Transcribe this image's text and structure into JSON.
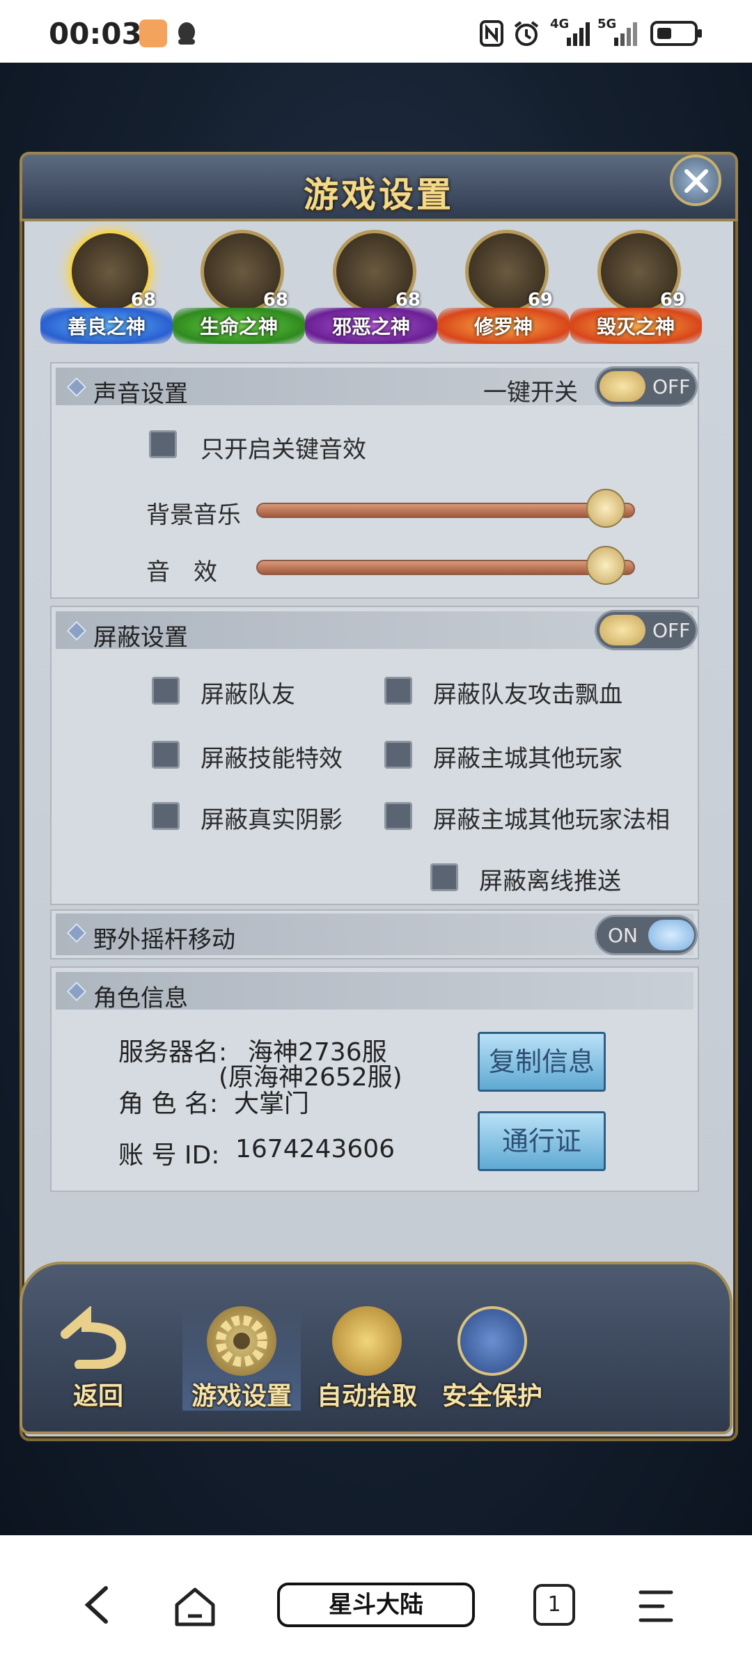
{
  "status_bar": {
    "time": "00:03",
    "icons": [
      "app-notification-icon",
      "qq-icon",
      "nfc-icon",
      "alarm-icon",
      "signal-4g-icon",
      "signal-5g-icon",
      "battery-icon"
    ],
    "signal_4g": "4G",
    "signal_5g": "5G"
  },
  "dialog": {
    "title": "游戏设置"
  },
  "gods": [
    {
      "name": "善良之神",
      "level": "68",
      "color": "#5fb8ff"
    },
    {
      "name": "生命之神",
      "level": "68",
      "color": "#6fd34a"
    },
    {
      "name": "邪恶之神",
      "level": "68",
      "color": "#b05ad8"
    },
    {
      "name": "修罗神",
      "level": "69",
      "color": "#ff7a2a"
    },
    {
      "name": "毁灭之神",
      "level": "69",
      "color": "#ff7a2a"
    }
  ],
  "sound": {
    "title": "声音设置",
    "master_label": "一键开关",
    "master_state": "OFF",
    "key_sound_only": "只开启关键音效",
    "bgm_label": "背景音乐",
    "sfx_label": "音　效",
    "bgm_level": 1.0,
    "sfx_level": 1.0
  },
  "block": {
    "title": "屏蔽设置",
    "state": "OFF",
    "options": [
      "屏蔽队友",
      "屏蔽队友攻击飘血",
      "屏蔽技能特效",
      "屏蔽主城其他玩家",
      "屏蔽真实阴影",
      "屏蔽主城其他玩家法相",
      "屏蔽离线推送"
    ]
  },
  "joystick": {
    "title": "野外摇杆移动",
    "state": "ON"
  },
  "role": {
    "title": "角色信息",
    "server_label": "服务器名:",
    "server_value": "海神2736服",
    "server_note": "(原海神2652服)",
    "name_label": "角 色 名:",
    "name_value": "大掌门",
    "id_label": "账 号 ID:",
    "id_value": "1674243606",
    "copy_button": "复制信息",
    "pass_button": "通行证"
  },
  "game_nav": {
    "back": "返回",
    "items": [
      "游戏设置",
      "自动拾取",
      "安全保护"
    ]
  },
  "browser": {
    "tab_title": "星斗大陆",
    "tab_count": "1"
  }
}
